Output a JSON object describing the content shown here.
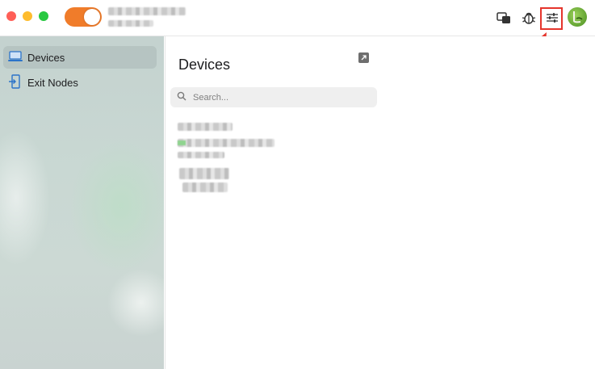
{
  "titlebar": {
    "vpn_toggle": {
      "state": "on",
      "color": "#f07c2a"
    },
    "account_name": "",
    "traffic_lights": {
      "close": "#ff5f57",
      "minimize": "#febc2e",
      "zoom": "#28c840"
    },
    "icons": [
      "screen-share-icon",
      "bug-icon",
      "settings-sliders-icon",
      "avatar"
    ]
  },
  "sidebar": {
    "items": [
      {
        "label": "Devices",
        "icon": "laptop-icon",
        "active": true
      },
      {
        "label": "Exit Nodes",
        "icon": "exit-door-icon",
        "active": false
      }
    ]
  },
  "devices_pane": {
    "title": "Devices",
    "search": {
      "placeholder": "Search...",
      "value": ""
    },
    "external_link_icon": "open-external-icon"
  },
  "annotation": {
    "color": "#e5352c",
    "target": "settings-sliders-icon"
  }
}
